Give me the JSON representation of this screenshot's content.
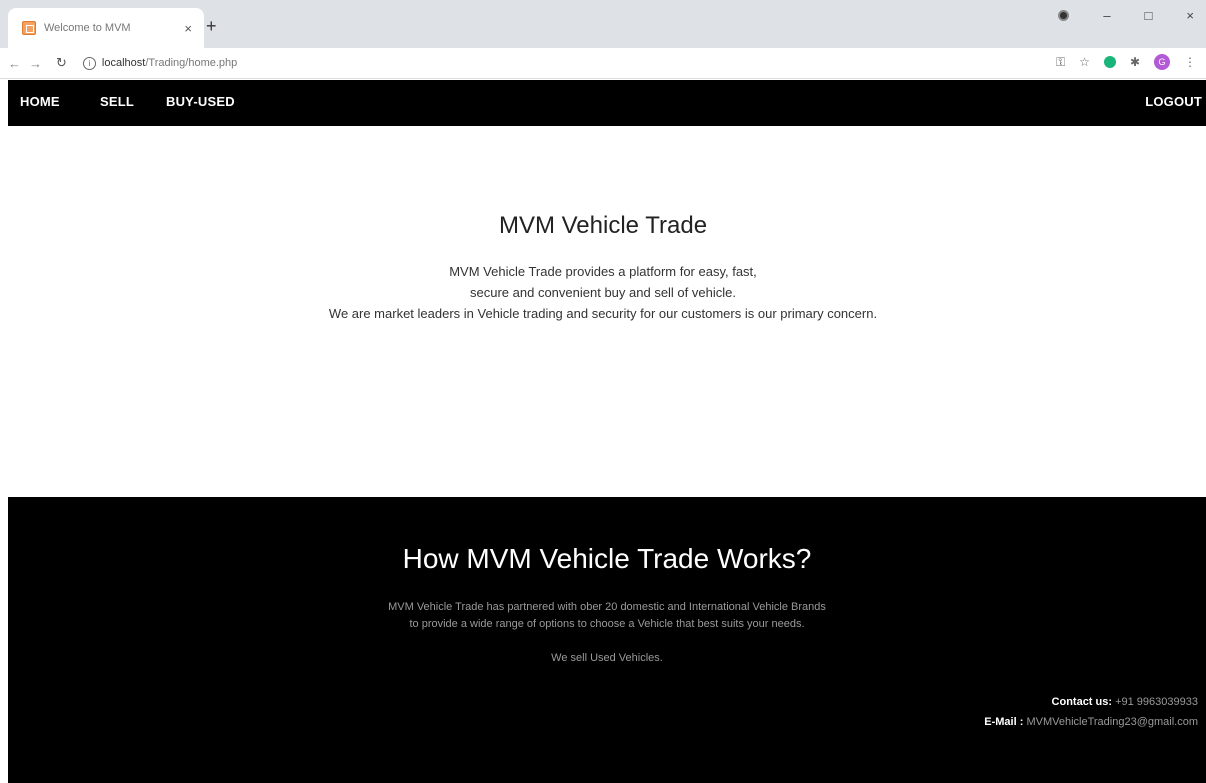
{
  "browser": {
    "tab_title": "Welcome to MVM",
    "tab_close": "×",
    "new_tab": "+",
    "url_host": "localhost",
    "url_path": "/Trading/home.php",
    "win_minimize": "–",
    "win_maximize": "□",
    "win_close": "×",
    "profile_initial": "G",
    "icons": {
      "back": "back-arrow-icon",
      "forward": "forward-arrow-icon",
      "reload": "reload-icon",
      "info": "info-icon",
      "key": "key-icon",
      "star": "star-icon",
      "extension": "extension-puzzle-icon",
      "menu": "kebab-menu-icon"
    }
  },
  "nav": {
    "home": "HOME",
    "sell": "SELL",
    "buy_used": "BUY-USED",
    "logout": "LOGOUT"
  },
  "hero": {
    "title": "MVM Vehicle Trade",
    "line1": "MVM Vehicle Trade provides a platform for easy, fast,",
    "line2": "secure and convenient buy and sell of vehicle.",
    "line3": "We are market leaders in Vehicle trading and security for our customers is our primary concern."
  },
  "footer": {
    "title": "How MVM Vehicle Trade Works?",
    "line1": "MVM Vehicle Trade has partnered with ober 20 domestic and International Vehicle Brands",
    "line2": "to provide a wide range of options to choose a Vehicle that best suits your needs.",
    "line3": "We sell Used Vehicles.",
    "contact_label": "Contact us:",
    "contact_value": "+91 9963039933",
    "email_label": "E-Mail :",
    "email_value": "MVMVehicleTrading23@gmail.com"
  },
  "colors": {
    "nav_bg": "#000000",
    "footer_bg": "#000000",
    "footer_muted_text": "#9a9a9a"
  }
}
